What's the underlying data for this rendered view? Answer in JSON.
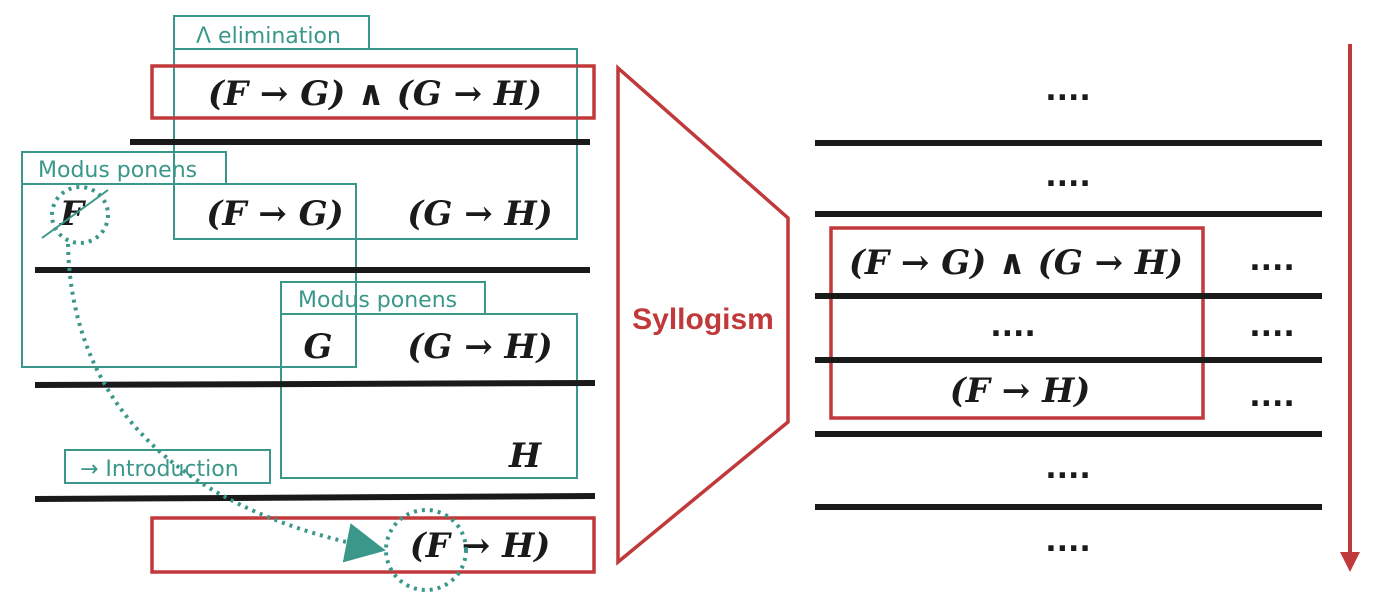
{
  "colors": {
    "teal": "#3a978a",
    "red": "#c0393b",
    "black": "#1a1a1a"
  },
  "left": {
    "and_elim_label": "Λ elimination",
    "premise": "(F → G) ∧ (G → H)",
    "mp1_label": "Modus ponens",
    "assumption": "F",
    "fg": "(F → G)",
    "gh1": "(G → H)",
    "mp2_label": "Modus ponens",
    "g": "G",
    "gh2": "(G → H)",
    "h": "H",
    "intro_label": "→ Introduction",
    "conclusion": "(F → H)"
  },
  "center": {
    "label": "Syllogism"
  },
  "right": {
    "dots": "....",
    "premise": "(F → G) ∧ (G → H)",
    "conclusion": "(F → H)"
  }
}
